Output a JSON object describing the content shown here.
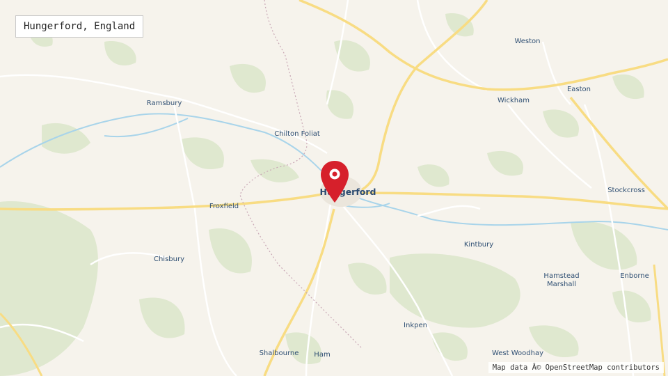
{
  "location_label": "Hungerford, England",
  "attribution": "Map data Â© OpenStreetMap contributors",
  "marker": {
    "icon": "map-pin-icon",
    "color": "#d6202b"
  },
  "colors": {
    "land": "#f6f3ec",
    "woodland": "#dfe8cf",
    "water": "#a8d4ea",
    "major_road": "#f8dc83",
    "minor_road": "#ffffff"
  },
  "places": [
    {
      "id": "weston",
      "name": "Weston"
    },
    {
      "id": "easton",
      "name": "Easton"
    },
    {
      "id": "ramsbury",
      "name": "Ramsbury"
    },
    {
      "id": "wickham",
      "name": "Wickham"
    },
    {
      "id": "chilton-foliat",
      "name": "Chilton Foliat"
    },
    {
      "id": "hungerford",
      "name": "Hungerford"
    },
    {
      "id": "stockcross",
      "name": "Stockcross"
    },
    {
      "id": "froxfield",
      "name": "Froxfield"
    },
    {
      "id": "kintbury",
      "name": "Kintbury"
    },
    {
      "id": "chisbury",
      "name": "Chisbury"
    },
    {
      "id": "hamstead-marshall",
      "name": "Hamstead",
      "name2": "Marshall"
    },
    {
      "id": "enborne",
      "name": "Enborne"
    },
    {
      "id": "inkpen",
      "name": "Inkpen"
    },
    {
      "id": "west-woodhay",
      "name": "West Woodhay"
    },
    {
      "id": "shalbourne",
      "name": "Shalbourne"
    },
    {
      "id": "ham",
      "name": "Ham"
    }
  ]
}
